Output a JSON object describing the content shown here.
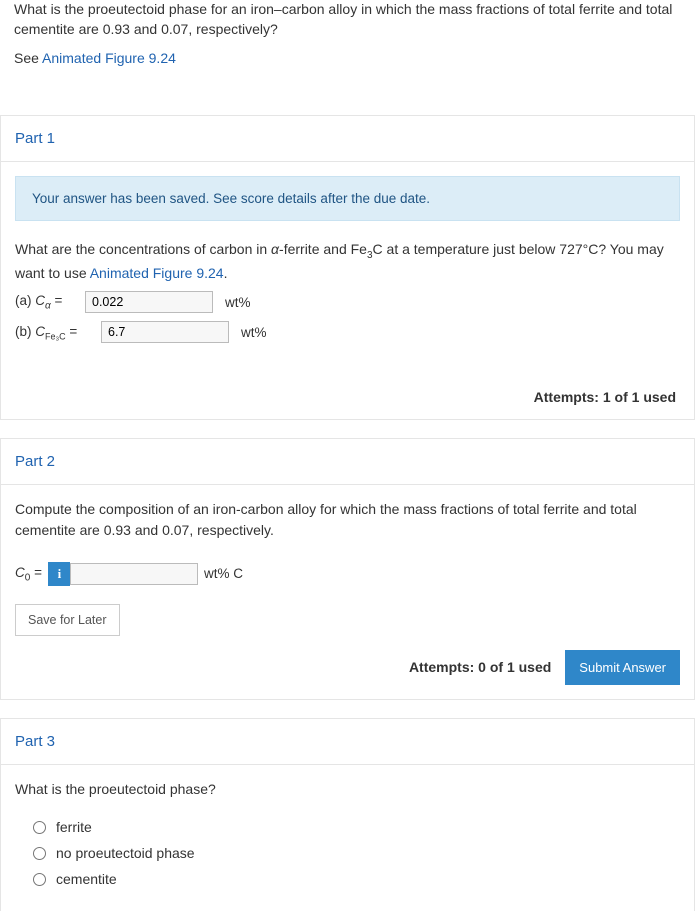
{
  "intro": {
    "question": "What is the proeutectoid phase for an iron–carbon alloy in which the mass fractions of total ferrite and total cementite are 0.93 and 0.07, respectively?",
    "see_prefix": "See ",
    "see_link": "Animated Figure 9.24"
  },
  "part1": {
    "title": "Part 1",
    "alert": "Your answer has been saved. See score details after the due date.",
    "q_prefix": "What are the concentrations of carbon in ",
    "q_alpha": "α",
    "q_mid": "-ferrite and Fe",
    "q_sub3": "3",
    "q_after": "C at a temperature just below 727°C?  You may want to use ",
    "q_link": "Animated Figure 9.24",
    "q_end": ".",
    "a_label_pre": "(a) ",
    "a_sym": "C",
    "a_sub": "α",
    "a_eq": " = ",
    "a_value": "0.022",
    "a_unit": "wt%",
    "b_label_pre": "(b) ",
    "b_sym": "C",
    "b_sub": "Fe₃C",
    "b_eq": " = ",
    "b_value": "6.7",
    "b_unit": "wt%",
    "attempts": "Attempts: 1 of 1 used"
  },
  "part2": {
    "title": "Part 2",
    "question": "Compute the composition of an iron-carbon alloy for which the mass fractions of total ferrite and total cementite are 0.93 and 0.07, respectively.",
    "label_sym": "C",
    "label_sub": "0",
    "label_eq": " = ",
    "value": "",
    "unit": "wt% C",
    "save_label": "Save for Later",
    "attempts": "Attempts: 0 of 1 used",
    "submit_label": "Submit Answer"
  },
  "part3": {
    "title": "Part 3",
    "question": "What is the proeutectoid phase?",
    "options": {
      "o1": "ferrite",
      "o2": "no proeutectoid phase",
      "o3": "cementite"
    }
  }
}
